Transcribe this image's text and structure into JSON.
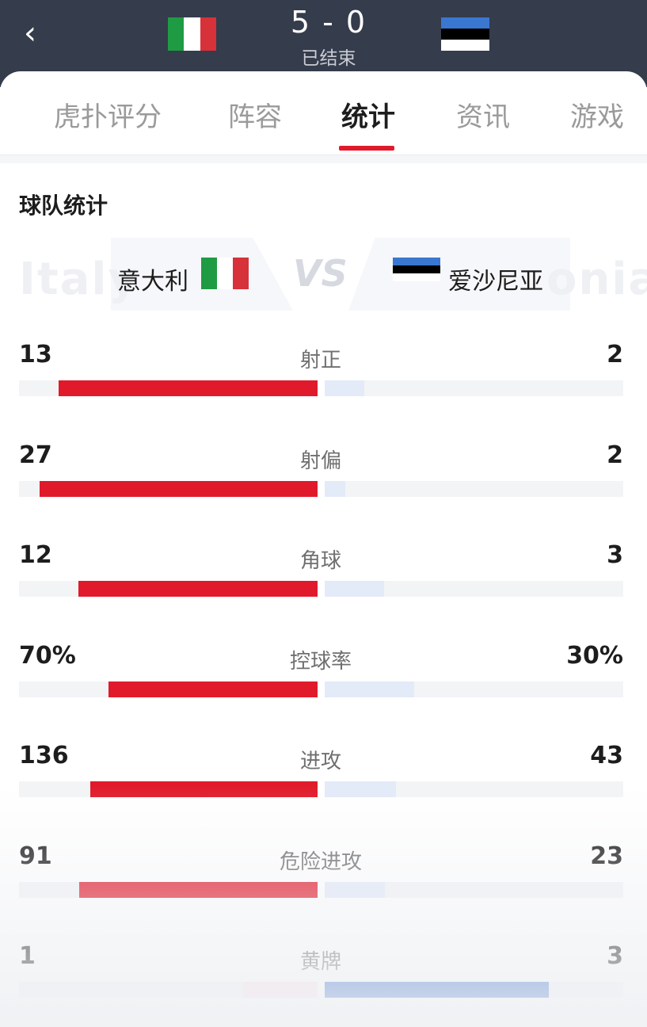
{
  "header": {
    "score": "5 - 0",
    "status": "已结束",
    "home_flag_colors": [
      "#1f9b44",
      "#ffffff",
      "#d7313a"
    ],
    "away_flag_colors": [
      "#3a77d1",
      "#000000",
      "#ffffff"
    ]
  },
  "tabs": [
    "虎扑评分",
    "阵容",
    "统计",
    "资讯",
    "游戏"
  ],
  "active_tab": "统计",
  "section_title": "球队统计",
  "teams": {
    "home": {
      "name": "意大利",
      "watermark": "Italy"
    },
    "away": {
      "name": "爱沙尼亚",
      "watermark": "onia"
    },
    "vs": "VS"
  },
  "stats": [
    {
      "label": "射正",
      "home": "13",
      "away": "2",
      "home_fraction": 0.867,
      "away_fraction": 0.133,
      "leader": "home"
    },
    {
      "label": "射偏",
      "home": "27",
      "away": "2",
      "home_fraction": 0.931,
      "away_fraction": 0.069,
      "leader": "home"
    },
    {
      "label": "角球",
      "home": "12",
      "away": "3",
      "home_fraction": 0.8,
      "away_fraction": 0.2,
      "leader": "home"
    },
    {
      "label": "控球率",
      "home": "70%",
      "away": "30%",
      "home_fraction": 0.7,
      "away_fraction": 0.3,
      "leader": "home"
    },
    {
      "label": "进攻",
      "home": "136",
      "away": "43",
      "home_fraction": 0.76,
      "away_fraction": 0.24,
      "leader": "home"
    },
    {
      "label": "危险进攻",
      "home": "91",
      "away": "23",
      "home_fraction": 0.798,
      "away_fraction": 0.202,
      "leader": "home"
    },
    {
      "label": "黄牌",
      "home": "1",
      "away": "3",
      "home_fraction": 0.25,
      "away_fraction": 0.75,
      "leader": "away"
    }
  ]
}
